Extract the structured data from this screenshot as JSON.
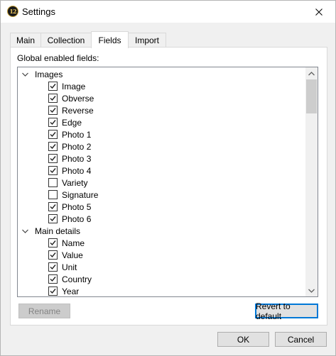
{
  "window": {
    "title": "Settings",
    "app_icon_text": "12"
  },
  "tabs": [
    {
      "label": "Main",
      "active": false
    },
    {
      "label": "Collection",
      "active": false
    },
    {
      "label": "Fields",
      "active": true
    },
    {
      "label": "Import",
      "active": false
    }
  ],
  "fields_panel": {
    "global_label": "Global enabled fields:",
    "groups": [
      {
        "label": "Images",
        "expanded": true,
        "items": [
          {
            "label": "Image",
            "checked": true
          },
          {
            "label": "Obverse",
            "checked": true
          },
          {
            "label": "Reverse",
            "checked": true
          },
          {
            "label": "Edge",
            "checked": true
          },
          {
            "label": "Photo 1",
            "checked": true
          },
          {
            "label": "Photo 2",
            "checked": true
          },
          {
            "label": "Photo 3",
            "checked": true
          },
          {
            "label": "Photo 4",
            "checked": true
          },
          {
            "label": "Variety",
            "checked": false
          },
          {
            "label": "Signature",
            "checked": false
          },
          {
            "label": "Photo 5",
            "checked": true
          },
          {
            "label": "Photo 6",
            "checked": true
          }
        ]
      },
      {
        "label": "Main details",
        "expanded": true,
        "items": [
          {
            "label": "Name",
            "checked": true
          },
          {
            "label": "Value",
            "checked": true
          },
          {
            "label": "Unit",
            "checked": true
          },
          {
            "label": "Country",
            "checked": true
          },
          {
            "label": "Year",
            "checked": true
          }
        ]
      }
    ],
    "rename_label": "Rename",
    "revert_label": "Revert to default"
  },
  "footer": {
    "ok_label": "OK",
    "cancel_label": "Cancel"
  },
  "icons": {
    "close": "close-icon",
    "expander": "chevron-down-icon",
    "scroll_up": "arrow-up-icon",
    "scroll_down": "arrow-down-icon",
    "check": "check-icon"
  }
}
